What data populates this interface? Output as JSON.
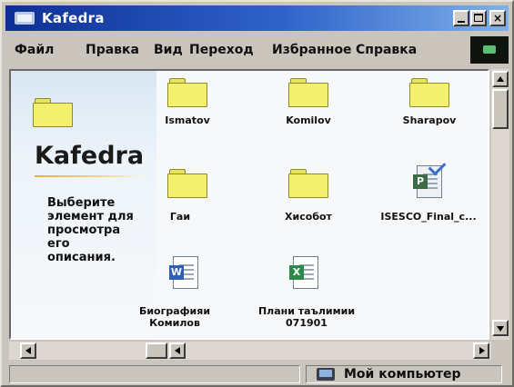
{
  "window": {
    "title": "Kafedra"
  },
  "menu": [
    "Файл",
    "Правка",
    "Вид",
    "Переход",
    "Избранное",
    "Справка"
  ],
  "left_panel": {
    "title": "Kafedra",
    "description": "Выберите\nэлемент для\nпросмотра\nего\nописания."
  },
  "items": [
    {
      "label": "Ismatov",
      "icon": "folder-icon"
    },
    {
      "label": "Komilov",
      "icon": "folder-icon"
    },
    {
      "label": "Sharapov",
      "icon": "folder-icon"
    },
    {
      "label": "Гаи",
      "icon": "folder-icon"
    },
    {
      "label": "Хисобот",
      "icon": "folder-icon"
    },
    {
      "label": "ISESCO_Final_c...",
      "icon": "project-document-icon"
    },
    {
      "label": "Биографияи\nКомилов",
      "icon": "word-document-icon"
    },
    {
      "label": "Плани таълимии\n071901",
      "icon": "excel-document-icon"
    }
  ],
  "status": {
    "location": "Мой компьютер"
  },
  "colors": {
    "title_start": "#0e2f95",
    "title_end": "#7fb0ea",
    "folder": "#f2f06d"
  }
}
